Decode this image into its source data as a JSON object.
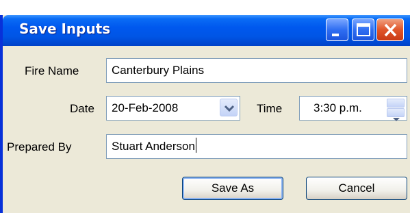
{
  "window": {
    "title": "Save Inputs",
    "controls": [
      "minimize-icon",
      "maximize-icon",
      "close-icon"
    ]
  },
  "form": {
    "fire_name_label": "Fire Name",
    "fire_name_value": "Canterbury Plains",
    "date_label": "Date",
    "date_value": "20-Feb-2008",
    "time_label": "Time",
    "time_value": "3:30 p.m.",
    "prepared_by_label": "Prepared By",
    "prepared_by_value": "Stuart Anderson"
  },
  "buttons": {
    "save_as": "Save As",
    "cancel": "Cancel"
  },
  "colors": {
    "titlebar": "#0058ee",
    "close": "#e0552a",
    "dialog_bg": "#ece9d8",
    "field_border": "#7f9db9"
  }
}
